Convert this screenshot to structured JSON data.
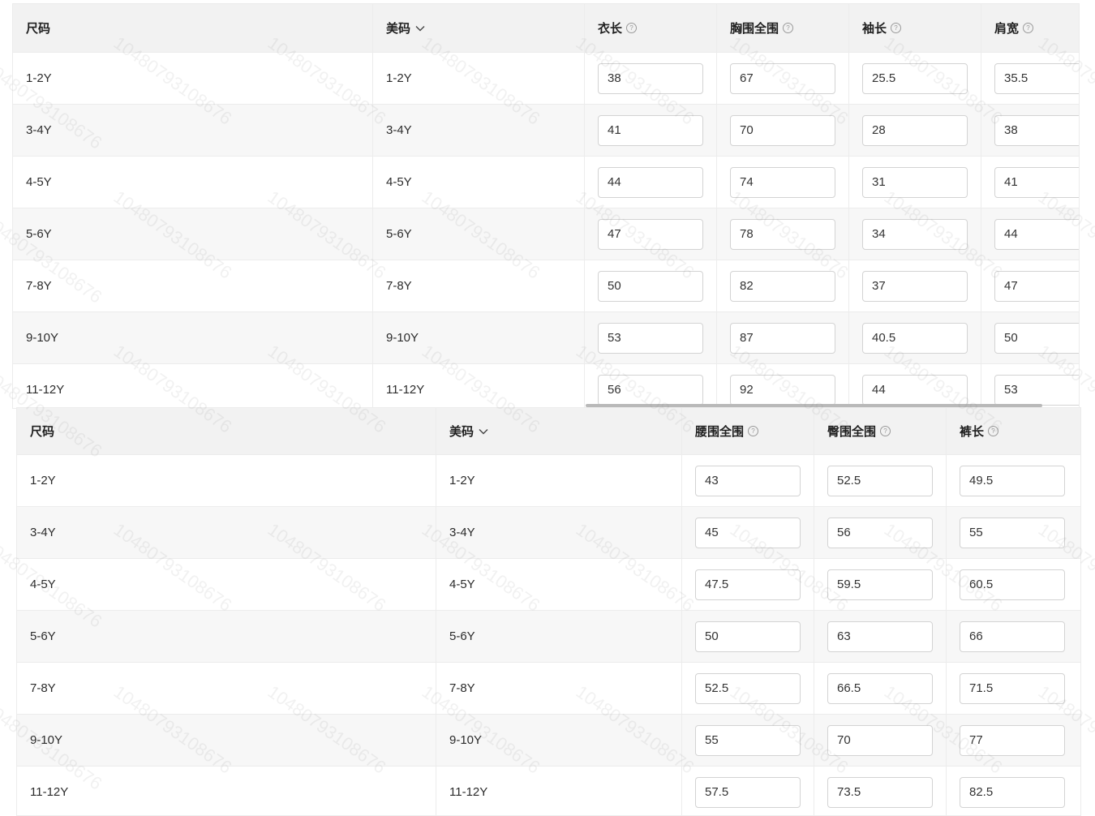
{
  "watermark": "1048079310867​6",
  "top_table": {
    "headers": {
      "size": "尺码",
      "us": "美码",
      "length": "衣长",
      "chest": "胸围全围",
      "sleeve": "袖长",
      "shoulder": "肩宽"
    },
    "rows": [
      {
        "size": "1-2Y",
        "us": "1-2Y",
        "length": "38",
        "chest": "67",
        "sleeve": "25.5",
        "shoulder": "35.5"
      },
      {
        "size": "3-4Y",
        "us": "3-4Y",
        "length": "41",
        "chest": "70",
        "sleeve": "28",
        "shoulder": "38"
      },
      {
        "size": "4-5Y",
        "us": "4-5Y",
        "length": "44",
        "chest": "74",
        "sleeve": "31",
        "shoulder": "41"
      },
      {
        "size": "5-6Y",
        "us": "5-6Y",
        "length": "47",
        "chest": "78",
        "sleeve": "34",
        "shoulder": "44"
      },
      {
        "size": "7-8Y",
        "us": "7-8Y",
        "length": "50",
        "chest": "82",
        "sleeve": "37",
        "shoulder": "47"
      },
      {
        "size": "9-10Y",
        "us": "9-10Y",
        "length": "53",
        "chest": "87",
        "sleeve": "40.5",
        "shoulder": "50"
      },
      {
        "size": "11-12Y",
        "us": "11-12Y",
        "length": "56",
        "chest": "92",
        "sleeve": "44",
        "shoulder": "53"
      }
    ]
  },
  "bottom_table": {
    "headers": {
      "size": "尺码",
      "us": "美码",
      "waist": "腰围全围",
      "hip": "臀围全围",
      "pants_length": "裤长"
    },
    "rows": [
      {
        "size": "1-2Y",
        "us": "1-2Y",
        "waist": "43",
        "hip": "52.5",
        "pants_length": "49.5"
      },
      {
        "size": "3-4Y",
        "us": "3-4Y",
        "waist": "45",
        "hip": "56",
        "pants_length": "55"
      },
      {
        "size": "4-5Y",
        "us": "4-5Y",
        "waist": "47.5",
        "hip": "59.5",
        "pants_length": "60.5"
      },
      {
        "size": "5-6Y",
        "us": "5-6Y",
        "waist": "50",
        "hip": "63",
        "pants_length": "66"
      },
      {
        "size": "7-8Y",
        "us": "7-8Y",
        "waist": "52.5",
        "hip": "66.5",
        "pants_length": "71.5"
      },
      {
        "size": "9-10Y",
        "us": "9-10Y",
        "waist": "55",
        "hip": "70",
        "pants_length": "77"
      },
      {
        "size": "11-12Y",
        "us": "11-12Y",
        "waist": "57.5",
        "hip": "73.5",
        "pants_length": "82.5"
      }
    ]
  },
  "icons": {
    "help": "question-circle-icon",
    "sort": "chevron-down-icon"
  }
}
